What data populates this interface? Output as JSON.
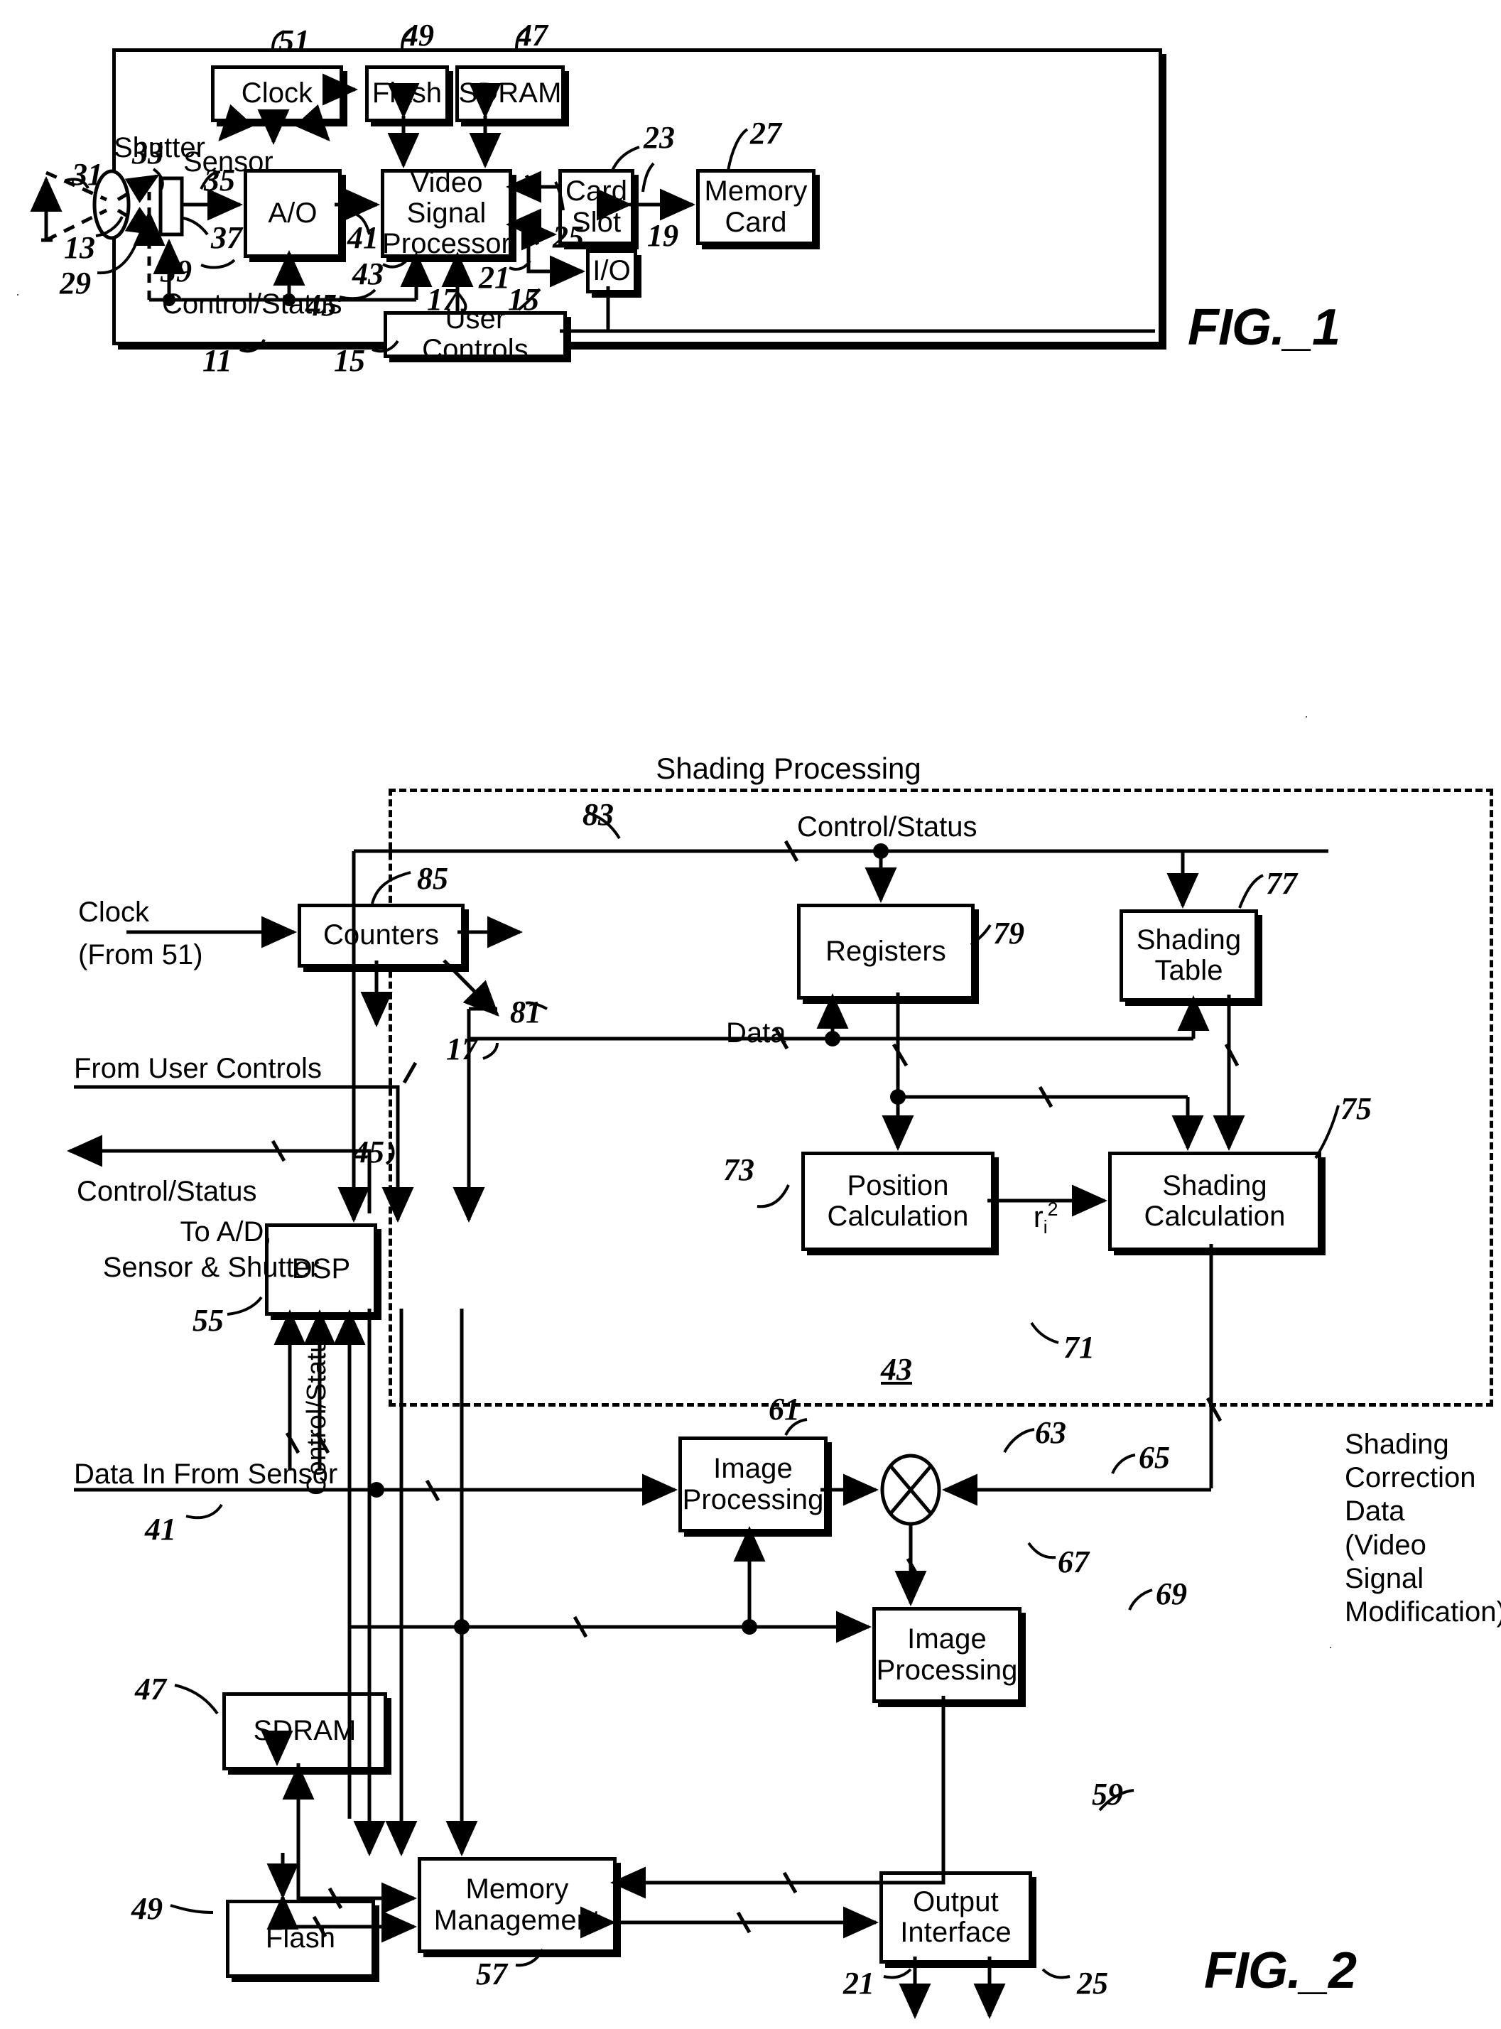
{
  "figure1": {
    "caption": "FIG._1",
    "blocks": [
      {
        "id": "clock",
        "label": "Clock"
      },
      {
        "id": "flash",
        "label": "Flash"
      },
      {
        "id": "sdram",
        "label": "SDRAM"
      },
      {
        "id": "ao",
        "label": "A/O"
      },
      {
        "id": "vsp",
        "label": "Video\nSignal\nProcessor"
      },
      {
        "id": "card_slot",
        "label": "Card\nSlot"
      },
      {
        "id": "memory_card",
        "label": "Memory\nCard"
      },
      {
        "id": "io",
        "label": "I/O"
      },
      {
        "id": "user_controls",
        "label": "User Controls"
      }
    ],
    "labels": {
      "shutter": "Shutter",
      "sensor": "Sensor",
      "control_status": "Control/Status"
    },
    "refs": [
      "51",
      "49",
      "47",
      "23",
      "27",
      "31",
      "33",
      "35",
      "37",
      "41",
      "25",
      "19",
      "13",
      "29",
      "39",
      "43",
      "45",
      "21",
      "17",
      "15",
      "15b",
      "11"
    ],
    "ref_values": {
      "r51": "51",
      "r49": "49",
      "r47": "47",
      "r23": "23",
      "r27": "27",
      "r31": "31",
      "r33": "33",
      "r35": "35",
      "r37": "37",
      "r41": "41",
      "r25": "25",
      "r19": "19",
      "r13": "13",
      "r29": "29",
      "r39": "39",
      "r43": "43",
      "r45": "45",
      "r21": "21",
      "r17": "17",
      "r15": "15",
      "r15b": "15",
      "r11": "11"
    }
  },
  "figure2": {
    "caption": "FIG._2",
    "region_title": "Shading Processing",
    "blocks": [
      {
        "id": "counters",
        "label": "Counters"
      },
      {
        "id": "registers",
        "label": "Registers"
      },
      {
        "id": "shading_table",
        "label": "Shading\nTable"
      },
      {
        "id": "position_calculation",
        "label": "Position\nCalculation"
      },
      {
        "id": "shading_calculation",
        "label": "Shading\nCalculation"
      },
      {
        "id": "dsp",
        "label": "DSP"
      },
      {
        "id": "image_processing_1",
        "label": "Image\nProcessing"
      },
      {
        "id": "image_processing_2",
        "label": "Image\nProcessing"
      },
      {
        "id": "memory_management",
        "label": "Memory\nManagement"
      },
      {
        "id": "output_interface",
        "label": "Output\nInterface"
      },
      {
        "id": "sdram",
        "label": "SDRAM"
      },
      {
        "id": "flash",
        "label": "Flash"
      }
    ],
    "labels": {
      "clock": "Clock",
      "clock_from": "(From 51)",
      "control_status_top": "Control/Status",
      "data": "Data",
      "from_user_controls": "From User Controls",
      "control_status_left": "Control/Status",
      "to_ad": "To A/D,",
      "sensor_shutter": "Sensor & Shutter",
      "data_in_from_sensor": "Data In From Sensor",
      "control_status_vert": "Control/Status",
      "ri2": "r",
      "ri2_sub": "i",
      "ri2_sup": "2",
      "shading_correction": "Shading\nCorrection\nData\n(Video Signal\nModification)"
    },
    "ref_values": {
      "r85": "85",
      "r83": "83",
      "r77": "77",
      "r79": "79",
      "r81": "81",
      "r75": "75",
      "r73": "73",
      "r17": "17",
      "r45": "45",
      "r55": "55",
      "r71": "71",
      "r43": "43",
      "r61": "61",
      "r63": "63",
      "r65": "65",
      "r67": "67",
      "r69": "69",
      "r41": "41",
      "r47": "47",
      "r49": "49",
      "r57": "57",
      "r59": "59",
      "r21": "21",
      "r25": "25"
    }
  },
  "colors": {
    "ink": "#000000",
    "paper": "#ffffff"
  }
}
